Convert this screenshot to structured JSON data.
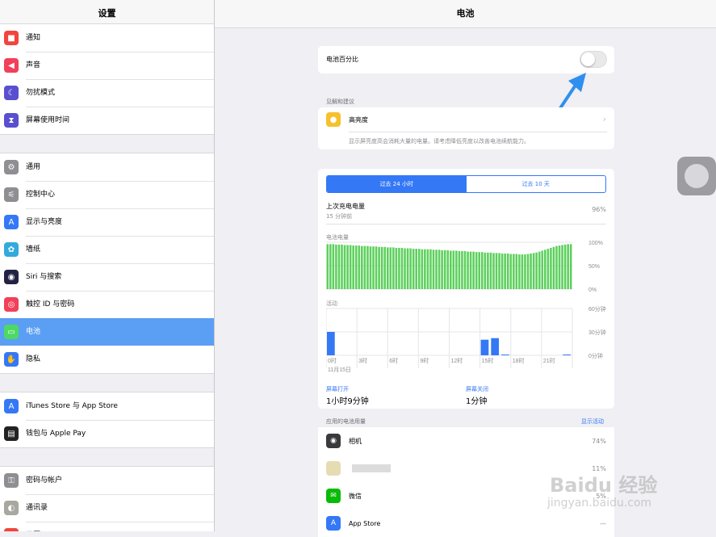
{
  "sidebar": {
    "title": "设置",
    "groups": [
      [
        {
          "label": "通知",
          "icon": "notifications-icon",
          "color": "#f2453d",
          "glyph": "■"
        },
        {
          "label": "声音",
          "icon": "sounds-icon",
          "color": "#f2405a",
          "glyph": "◀"
        },
        {
          "label": "勿扰模式",
          "icon": "moon-icon",
          "color": "#5a4fcf",
          "glyph": "☾"
        },
        {
          "label": "屏幕使用时间",
          "icon": "hourglass-icon",
          "color": "#5a4fcf",
          "glyph": "⧗"
        }
      ],
      [
        {
          "label": "通用",
          "icon": "gear-icon",
          "color": "#8e8e93",
          "glyph": "⚙"
        },
        {
          "label": "控制中心",
          "icon": "control-center-icon",
          "color": "#8e8e93",
          "glyph": "⚟"
        },
        {
          "label": "显示与亮度",
          "icon": "display-icon",
          "color": "#3478f6",
          "glyph": "A"
        },
        {
          "label": "墙纸",
          "icon": "wallpaper-icon",
          "color": "#32aadc",
          "glyph": "✿"
        },
        {
          "label": "Siri 与搜索",
          "icon": "siri-icon",
          "color": "#222244",
          "glyph": "◉"
        },
        {
          "label": "触控 ID 与密码",
          "icon": "fingerprint-icon",
          "color": "#f2405a",
          "glyph": "◎"
        },
        {
          "label": "电池",
          "icon": "battery-icon",
          "color": "#4cd964",
          "glyph": "▭",
          "selected": true
        },
        {
          "label": "隐私",
          "icon": "hand-icon",
          "color": "#3478f6",
          "glyph": "✋"
        }
      ],
      [
        {
          "label": "iTunes Store 与 App Store",
          "icon": "app-store-icon",
          "color": "#3478f6",
          "glyph": "A"
        },
        {
          "label": "钱包与 Apple Pay",
          "icon": "wallet-icon",
          "color": "#222222",
          "glyph": "▤"
        }
      ],
      [
        {
          "label": "密码与帐户",
          "icon": "key-icon",
          "color": "#8e8e93",
          "glyph": "⚿"
        },
        {
          "label": "通讯录",
          "icon": "contacts-icon",
          "color": "#a8a8a0",
          "glyph": "◐"
        },
        {
          "label": "日历",
          "icon": "calendar-icon",
          "color": "#f2453d",
          "glyph": "▦"
        }
      ]
    ]
  },
  "main": {
    "title": "电池",
    "battery_percentage_label": "电池百分比",
    "battery_percentage_on": false,
    "insights_header": "见解和建议",
    "high_brightness_label": "高亮度",
    "high_brightness_desc": "显示屏亮度高会消耗大量的电量。请考虑降低亮度以改善电池续航能力。",
    "segments": [
      "过去 24 小时",
      "过去 10 天"
    ],
    "last_charge_label": "上次充电电量",
    "last_charge_time": "15 分钟前",
    "last_charge_value": "96%",
    "battery_chart_label": "电池电量",
    "battery_ticks": [
      "100%",
      "50%",
      "0%"
    ],
    "activity_chart_label": "活动",
    "activity_ticks": [
      "60分钟",
      "30分钟",
      "0分钟"
    ],
    "x_ticks": [
      "0时",
      "3时",
      "6时",
      "9时",
      "12时",
      "15时",
      "18时",
      "21时"
    ],
    "date_label": "11月15日",
    "screen_on_label": "屏幕打开",
    "screen_on_value": "1小时9分钟",
    "screen_off_label": "屏幕关闭",
    "screen_off_value": "1分钟",
    "app_usage_header": "应用的电池用量",
    "show_activity": "显示活动",
    "apps": [
      {
        "name": "相机",
        "pct": "74%",
        "icon": "camera-icon",
        "color": "#3a3a3c",
        "glyph": "◉"
      },
      {
        "name": "",
        "pct": "11%",
        "icon": "blurred-app-icon",
        "color": "#e6dcb4",
        "glyph": ""
      },
      {
        "name": "微信",
        "pct": "5%",
        "icon": "wechat-icon",
        "color": "#09bb07",
        "glyph": "✉"
      },
      {
        "name": "App Store",
        "pct": "—",
        "icon": "app-store-icon",
        "color": "#3478f6",
        "glyph": "A"
      }
    ],
    "watermark_line1": "Baidu 经验",
    "watermark_line2": "jingyan.baidu.com"
  },
  "chart_data": [
    {
      "type": "bar",
      "title": "电池电量",
      "categories_note": "hourly",
      "x": [
        "0时",
        "3时",
        "6时",
        "9时",
        "12时",
        "15时",
        "18时",
        "21时"
      ],
      "values": [
        96,
        96,
        96,
        95,
        95,
        95,
        94,
        94,
        94,
        93,
        93,
        93,
        92,
        92,
        92,
        91,
        91,
        91,
        90,
        90,
        90,
        89,
        89,
        89,
        88,
        88,
        88,
        87,
        87,
        87,
        86,
        86,
        86,
        85,
        85,
        85,
        85,
        84,
        84,
        84,
        83,
        83,
        83,
        82,
        82,
        82,
        81,
        81,
        81,
        80,
        80,
        80,
        79,
        79,
        79,
        78,
        78,
        78,
        77,
        77,
        77,
        76,
        76,
        76,
        75,
        75,
        75,
        74,
        74,
        74,
        75,
        76,
        77,
        78,
        80,
        82,
        84,
        86,
        88,
        90,
        92,
        93,
        94,
        95,
        96,
        96
      ],
      "ylim": [
        0,
        100
      ],
      "yticks": [
        "100%",
        "50%",
        "0%"
      ]
    },
    {
      "type": "bar",
      "title": "活动",
      "x": [
        "0时",
        "3时",
        "6时",
        "9时",
        "12时",
        "15时",
        "18时",
        "21时"
      ],
      "values": [
        30,
        0,
        0,
        0,
        0,
        0,
        0,
        0,
        0,
        0,
        0,
        0,
        0,
        0,
        0,
        20,
        22,
        1,
        0,
        0,
        0,
        0,
        0,
        1
      ],
      "ylim": [
        0,
        60
      ],
      "yticks": [
        "60分钟",
        "30分钟",
        "0分钟"
      ]
    }
  ]
}
